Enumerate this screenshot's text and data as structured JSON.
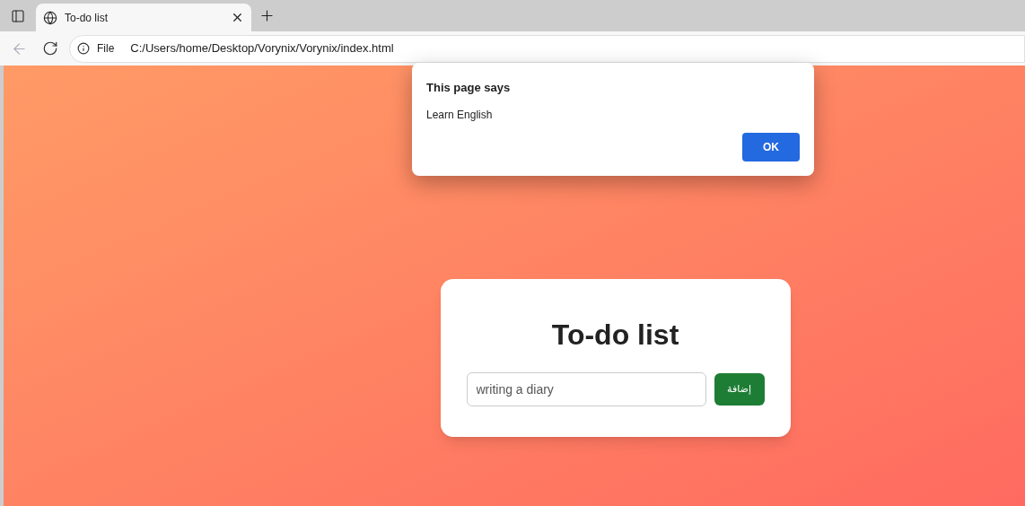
{
  "browser": {
    "tabs": [
      {
        "title": "To-do list",
        "selected": true
      }
    ],
    "address": {
      "scheme": "File",
      "url": "C:/Users/home/Desktop/Vorynix/Vorynix/index.html"
    }
  },
  "dialog": {
    "title": "This page says",
    "message": "Learn English",
    "button": "OK"
  },
  "card": {
    "title": "To-do list",
    "input": {
      "value": "writing a diary"
    },
    "add_button": "إضافة"
  }
}
